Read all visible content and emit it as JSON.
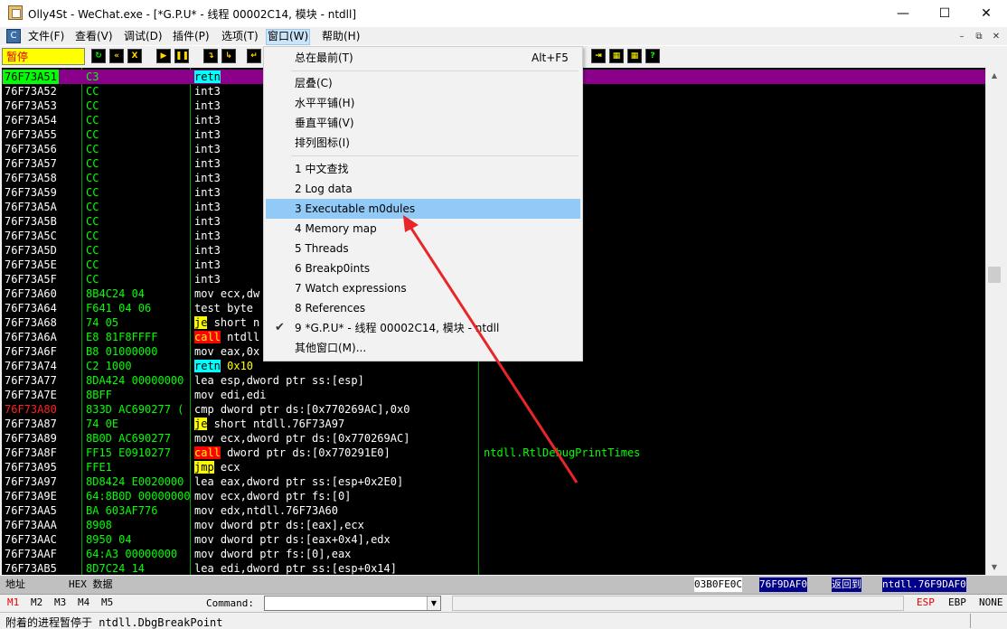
{
  "window": {
    "title": "Olly4St - WeChat.exe - [*G.P.U* -  线程  00002C14, 模块 - ntdll]",
    "min": "—",
    "max": "☐",
    "close": "✕"
  },
  "menubar": {
    "items": [
      "文件(F)",
      "查看(V)",
      "调试(D)",
      "插件(P)",
      "选项(T)",
      "窗口(W)",
      "帮助(H)"
    ],
    "mdi_min": "–",
    "mdi_restore": "⧉",
    "mdi_close": "✕"
  },
  "toolbar": {
    "status": "暂停",
    "buttons": [
      "↻",
      "«",
      "X",
      "▶",
      "❚❚",
      "↴",
      "↳",
      "↵",
      "⇥",
      "▦",
      "▦",
      "?"
    ]
  },
  "dropdown": {
    "items": [
      {
        "label": "总在最前(T)",
        "shortcut": "Alt+F5"
      },
      {
        "label": "层叠(C)"
      },
      {
        "label": "水平平铺(H)"
      },
      {
        "label": "垂直平铺(V)"
      },
      {
        "label": "排列图标(I)"
      },
      {
        "label": "1 中文查找"
      },
      {
        "label": "2 Log data"
      },
      {
        "label": "3 Executable m0dules"
      },
      {
        "label": "4 Memory map"
      },
      {
        "label": "5 Threads"
      },
      {
        "label": "6 Breakp0ints"
      },
      {
        "label": "7 Watch expressions"
      },
      {
        "label": "8 References"
      },
      {
        "label": "9 *G.P.U* -  线程  00002C14, 模块 - ntdll"
      },
      {
        "label": "其他窗口(M)..."
      }
    ],
    "check": "✔"
  },
  "disasm": {
    "rows": [
      {
        "addr": "76F73A51",
        "hex": "C3",
        "asm": "retn",
        "comment": ""
      },
      {
        "addr": "76F73A52",
        "hex": "CC",
        "asm": "int3",
        "comment": ""
      },
      {
        "addr": "76F73A53",
        "hex": "CC",
        "asm": "int3",
        "comment": ""
      },
      {
        "addr": "76F73A54",
        "hex": "CC",
        "asm": "int3",
        "comment": ""
      },
      {
        "addr": "76F73A55",
        "hex": "CC",
        "asm": "int3",
        "comment": ""
      },
      {
        "addr": "76F73A56",
        "hex": "CC",
        "asm": "int3",
        "comment": ""
      },
      {
        "addr": "76F73A57",
        "hex": "CC",
        "asm": "int3",
        "comment": ""
      },
      {
        "addr": "76F73A58",
        "hex": "CC",
        "asm": "int3",
        "comment": ""
      },
      {
        "addr": "76F73A59",
        "hex": "CC",
        "asm": "int3",
        "comment": ""
      },
      {
        "addr": "76F73A5A",
        "hex": "CC",
        "asm": "int3",
        "comment": ""
      },
      {
        "addr": "76F73A5B",
        "hex": "CC",
        "asm": "int3",
        "comment": ""
      },
      {
        "addr": "76F73A5C",
        "hex": "CC",
        "asm": "int3",
        "comment": ""
      },
      {
        "addr": "76F73A5D",
        "hex": "CC",
        "asm": "int3",
        "comment": ""
      },
      {
        "addr": "76F73A5E",
        "hex": "CC",
        "asm": "int3",
        "comment": ""
      },
      {
        "addr": "76F73A5F",
        "hex": "CC",
        "asm": "int3",
        "comment": ""
      },
      {
        "addr": "76F73A60",
        "hex": "8B4C24 04",
        "asm": "mov ecx,dw",
        "comment": ""
      },
      {
        "addr": "76F73A64",
        "hex": "F641 04 06",
        "asm": "test byte",
        "comment": ""
      },
      {
        "addr": "76F73A68",
        "hex": "74 05",
        "asm": "je short n",
        "comment": ""
      },
      {
        "addr": "76F73A6A",
        "hex": "E8 81F8FFFF",
        "asm": "call ntdll",
        "comment": ""
      },
      {
        "addr": "76F73A6F",
        "hex": "B8 01000000",
        "asm": "mov eax,0x",
        "comment": ""
      },
      {
        "addr": "76F73A74",
        "hex": "C2 1000",
        "asm": "retn 0x10",
        "comment": ""
      },
      {
        "addr": "76F73A77",
        "hex": "8DA424 00000000",
        "asm": "lea esp,dword ptr ss:[esp]",
        "comment": ""
      },
      {
        "addr": "76F73A7E",
        "hex": "8BFF",
        "asm": "mov edi,edi",
        "comment": ""
      },
      {
        "addr": "76F73A80",
        "hex": "833D AC690277 (",
        "asm": "cmp dword ptr ds:[0x770269AC],0x0",
        "comment": ""
      },
      {
        "addr": "76F73A87",
        "hex": "74 0E",
        "asm": "je short ntdll.76F73A97",
        "comment": ""
      },
      {
        "addr": "76F73A89",
        "hex": "8B0D AC690277",
        "asm": "mov ecx,dword ptr ds:[0x770269AC]",
        "comment": ""
      },
      {
        "addr": "76F73A8F",
        "hex": "FF15 E0910277",
        "asm": "call dword ptr ds:[0x770291E0]",
        "comment": "ntdll.RtlDebugPrintTimes"
      },
      {
        "addr": "76F73A95",
        "hex": "FFE1",
        "asm": "jmp ecx",
        "comment": ""
      },
      {
        "addr": "76F73A97",
        "hex": "8D8424 E0020000",
        "asm": "lea eax,dword ptr ss:[esp+0x2E0]",
        "comment": ""
      },
      {
        "addr": "76F73A9E",
        "hex": "64:8B0D 00000000",
        "asm": "mov ecx,dword ptr fs:[0]",
        "comment": ""
      },
      {
        "addr": "76F73AA5",
        "hex": "BA 603AF776",
        "asm": "mov edx,ntdll.76F73A60",
        "comment": ""
      },
      {
        "addr": "76F73AAA",
        "hex": "8908",
        "asm": "mov dword ptr ds:[eax],ecx",
        "comment": ""
      },
      {
        "addr": "76F73AAC",
        "hex": "8950 04",
        "asm": "mov dword ptr ds:[eax+0x4],edx",
        "comment": ""
      },
      {
        "addr": "76F73AAF",
        "hex": "64:A3 00000000",
        "asm": "mov dword ptr fs:[0],eax",
        "comment": ""
      },
      {
        "addr": "76F73AB5",
        "hex": "8D7C24 14",
        "asm": "lea edi,dword ptr ss:[esp+0x14]",
        "comment": ""
      }
    ]
  },
  "bottom": {
    "left_label": "地址",
    "hex_label": "HEX 数据",
    "right1": "03B0FE0C",
    "right2": "76F9DAF0",
    "right3": "返回到",
    "right4": "ntdll.76F9DAF0"
  },
  "cmdbar": {
    "marks": [
      "M1",
      "M2",
      "M3",
      "M4",
      "M5"
    ],
    "command_label": "Command:",
    "drop": "▼",
    "regs": [
      "ESP",
      "EBP",
      "NONE"
    ]
  },
  "statusbar": {
    "message": "附着的进程暂停于 ntdll.DbgBreakPoint"
  },
  "colors": {
    "selected_row": "#8b008b",
    "disasm_bg": "#000000",
    "hex_green": "#00ff00",
    "menu_highlight": "#91c9f7",
    "arrow": "#e8262a"
  }
}
